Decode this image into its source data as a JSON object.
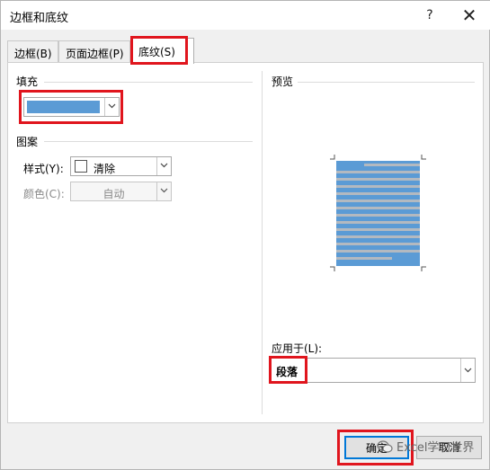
{
  "window": {
    "title": "边框和底纹",
    "help_label": "?",
    "close_label": "✕"
  },
  "tabs": [
    {
      "label": "边框(B)"
    },
    {
      "label": "页面边框(P)"
    },
    {
      "label": "底纹(S)",
      "active": true
    }
  ],
  "fill": {
    "section_label": "填充",
    "selected_color": "#5b9bd5"
  },
  "pattern": {
    "section_label": "图案",
    "style_label": "样式(Y):",
    "style_value": "清除",
    "color_label": "颜色(C):",
    "color_value": "自动",
    "color_enabled": false
  },
  "preview": {
    "section_label": "预览"
  },
  "apply_to": {
    "label": "应用于(L):",
    "value": "段落"
  },
  "buttons": {
    "ok_label": "确定",
    "cancel_label": "取消"
  },
  "watermark": {
    "text": "Excel学习世界"
  },
  "colors": {
    "highlight": "#e0151d",
    "shading": "#5b9bd5",
    "preview_lines": "#b3b9c0"
  }
}
